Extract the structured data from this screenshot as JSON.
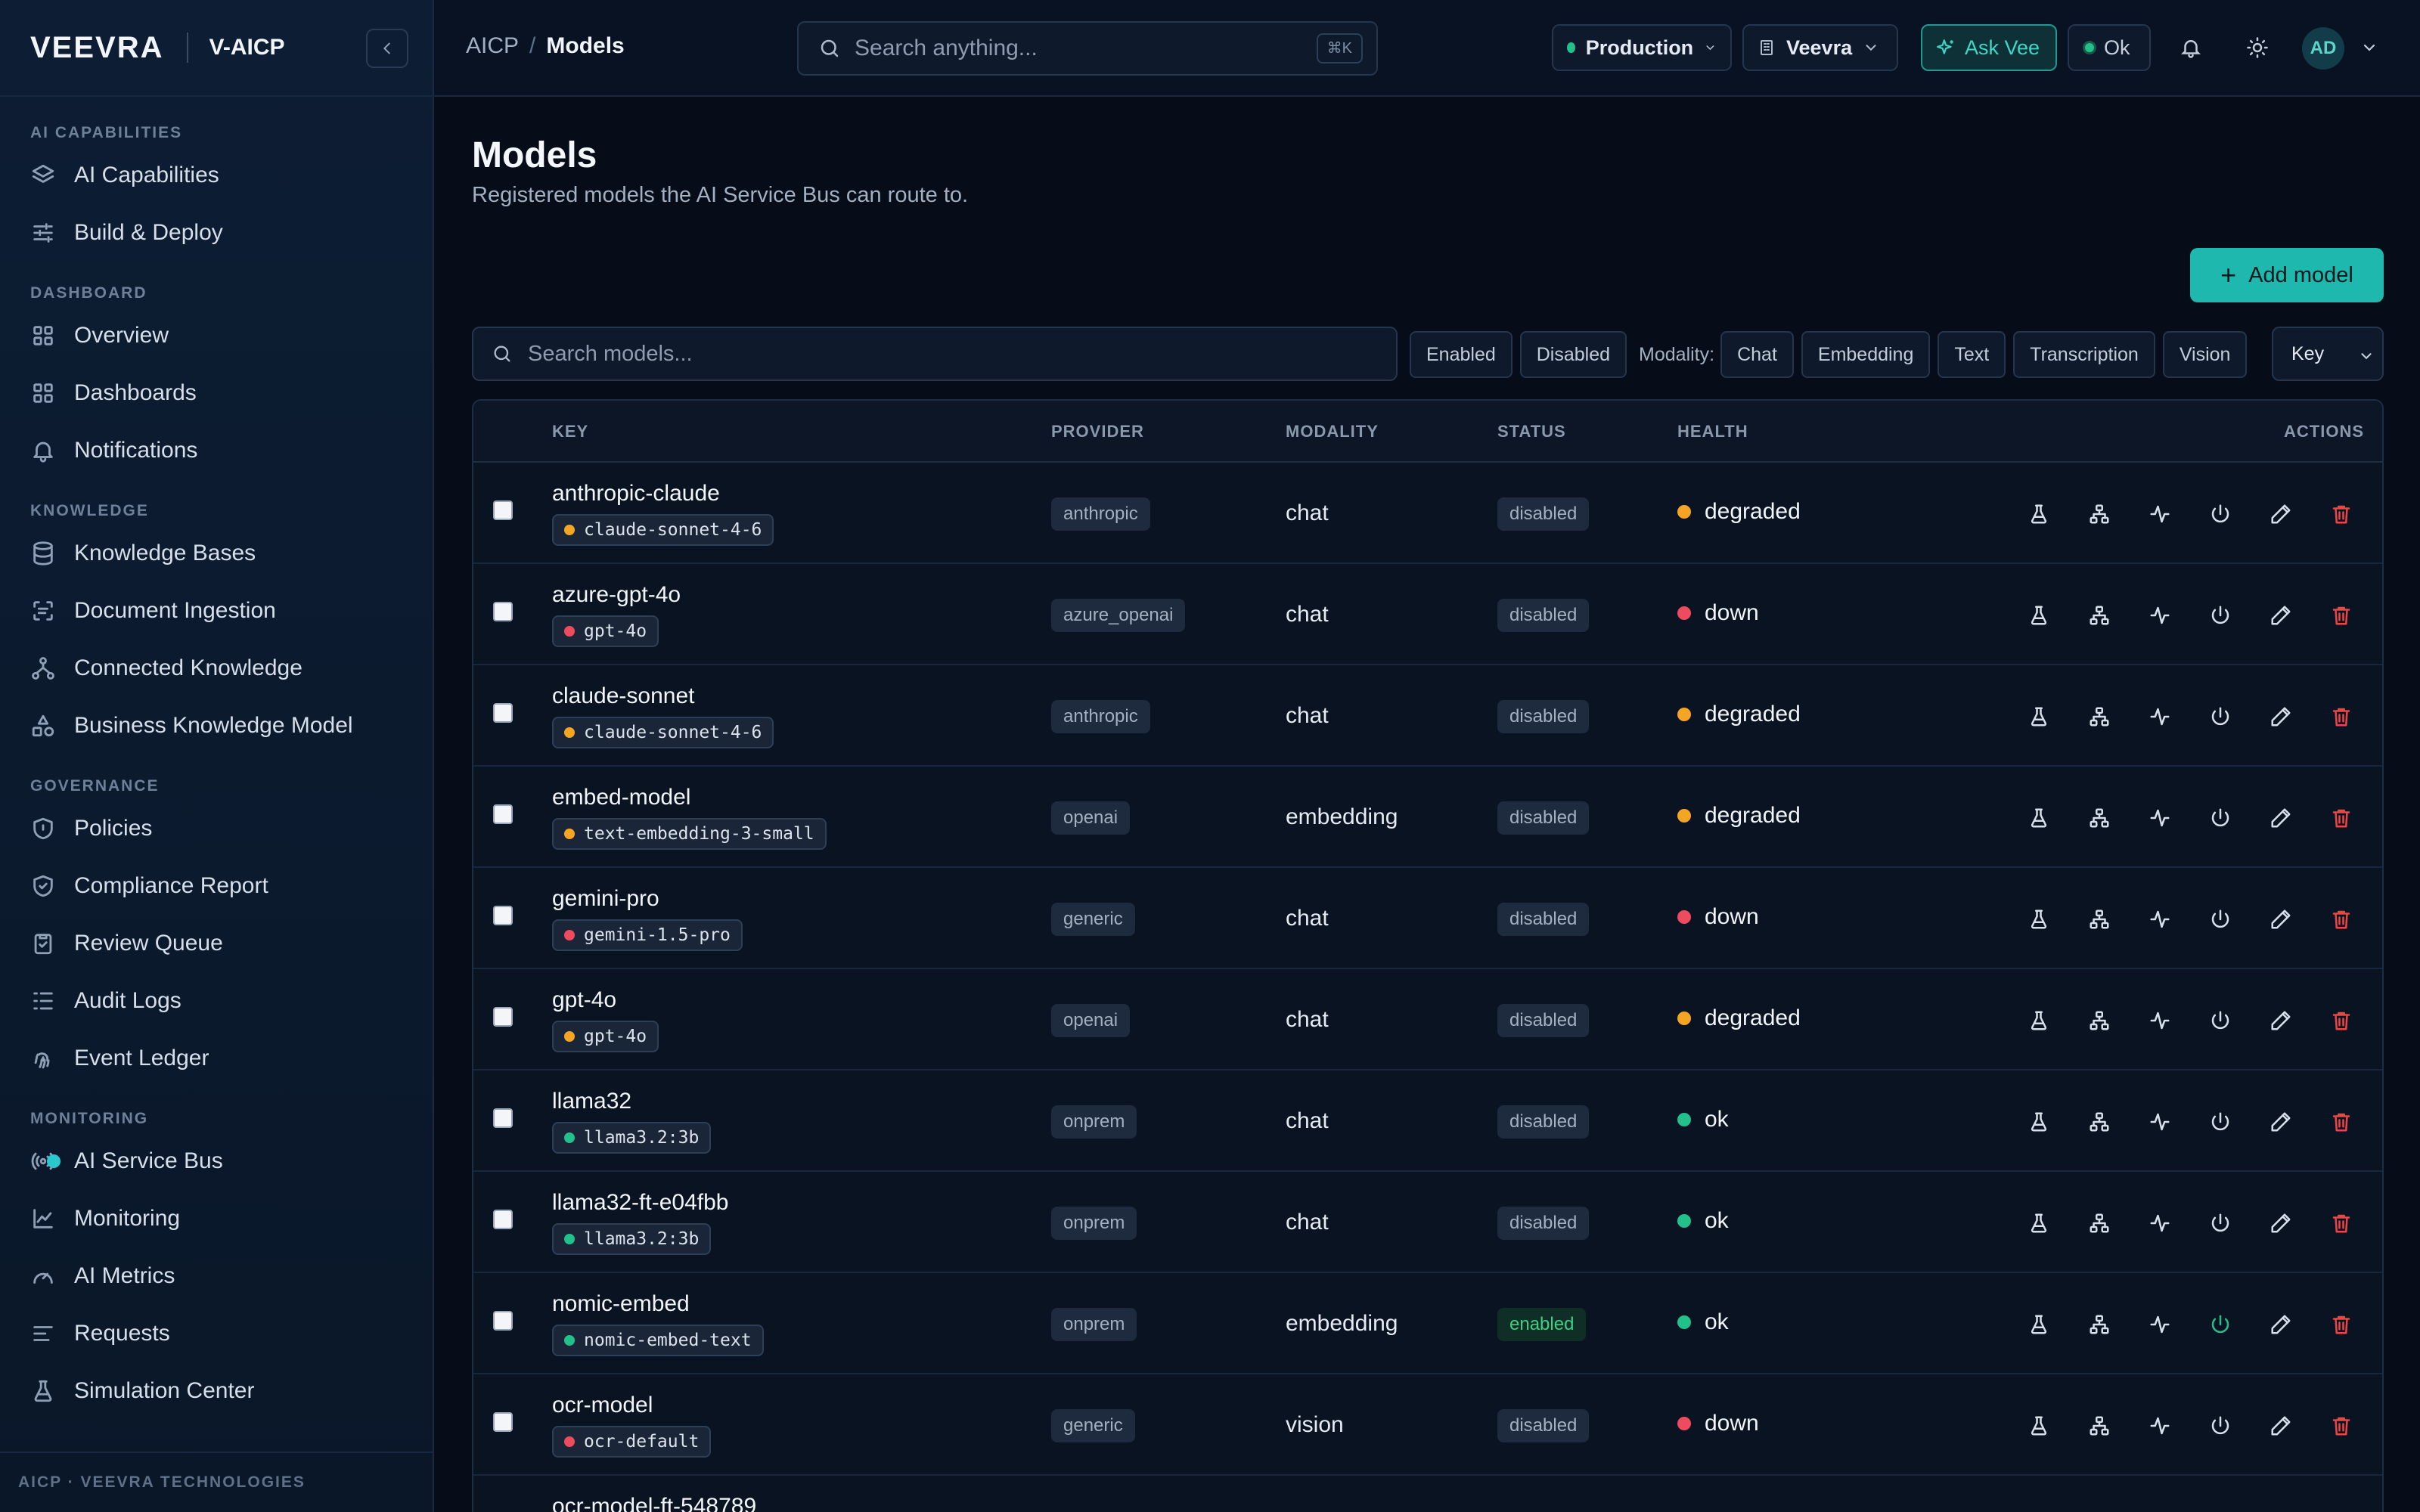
{
  "brand": {
    "logo": "VEEVRA",
    "product": "V-AICP"
  },
  "sidebar": {
    "sections": [
      {
        "title": "AI CAPABILITIES",
        "items": [
          {
            "label": "AI Capabilities",
            "icon": "layers-icon"
          },
          {
            "label": "Build & Deploy",
            "icon": "sliders-icon"
          }
        ]
      },
      {
        "title": "DASHBOARD",
        "items": [
          {
            "label": "Overview",
            "icon": "grid-icon"
          },
          {
            "label": "Dashboards",
            "icon": "grid-icon"
          },
          {
            "label": "Notifications",
            "icon": "bell-icon"
          }
        ]
      },
      {
        "title": "KNOWLEDGE",
        "items": [
          {
            "label": "Knowledge Bases",
            "icon": "database-icon"
          },
          {
            "label": "Document Ingestion",
            "icon": "scan-icon"
          },
          {
            "label": "Connected Knowledge",
            "icon": "network-icon"
          },
          {
            "label": "Business Knowledge Model",
            "icon": "shapes-icon"
          }
        ]
      },
      {
        "title": "GOVERNANCE",
        "items": [
          {
            "label": "Policies",
            "icon": "shield-icon"
          },
          {
            "label": "Compliance Report",
            "icon": "shield-check-icon"
          },
          {
            "label": "Review Queue",
            "icon": "clipboard-icon"
          },
          {
            "label": "Audit Logs",
            "icon": "logs-icon"
          },
          {
            "label": "Event Ledger",
            "icon": "fingerprint-icon"
          }
        ]
      },
      {
        "title": "MONITORING",
        "items": [
          {
            "label": "AI Service Bus",
            "icon": "radio-icon"
          },
          {
            "label": "Monitoring",
            "icon": "chart-line-icon"
          },
          {
            "label": "AI Metrics",
            "icon": "gauge-icon"
          },
          {
            "label": "Requests",
            "icon": "list-icon"
          },
          {
            "label": "Simulation Center",
            "icon": "flask-icon"
          }
        ]
      }
    ],
    "footer": "AICP · VEEVRA TECHNOLOGIES"
  },
  "topbar": {
    "breadcrumb": {
      "parent": "AICP",
      "separator": "/",
      "current": "Models"
    },
    "search_placeholder": "Search anything...",
    "shortcut": "⌘K",
    "environment": "Production",
    "org": "Veevra",
    "ask_label": "Ask Vee",
    "status_label": "Ok",
    "avatar_initials": "AD"
  },
  "page": {
    "title": "Models",
    "subtitle": "Registered models the AI Service Bus can route to.",
    "add_label": "Add model",
    "search_placeholder": "Search models...",
    "filters": {
      "status": [
        "Enabled",
        "Disabled"
      ],
      "modality_label": "Modality:",
      "modality": [
        "Chat",
        "Embedding",
        "Text",
        "Transcription",
        "Vision"
      ]
    },
    "sort": "Key"
  },
  "table": {
    "columns": {
      "key": "KEY",
      "provider": "PROVIDER",
      "modality": "MODALITY",
      "status": "STATUS",
      "health": "HEALTH",
      "actions": "ACTIONS"
    },
    "rows": [
      {
        "key": "anthropic-claude",
        "model": "claude-sonnet-4-6",
        "provider": "anthropic",
        "modality": "chat",
        "status": "disabled",
        "health": "degraded"
      },
      {
        "key": "azure-gpt-4o",
        "model": "gpt-4o",
        "provider": "azure_openai",
        "modality": "chat",
        "status": "disabled",
        "health": "down"
      },
      {
        "key": "claude-sonnet",
        "model": "claude-sonnet-4-6",
        "provider": "anthropic",
        "modality": "chat",
        "status": "disabled",
        "health": "degraded"
      },
      {
        "key": "embed-model",
        "model": "text-embedding-3-small",
        "provider": "openai",
        "modality": "embedding",
        "status": "disabled",
        "health": "degraded"
      },
      {
        "key": "gemini-pro",
        "model": "gemini-1.5-pro",
        "provider": "generic",
        "modality": "chat",
        "status": "disabled",
        "health": "down"
      },
      {
        "key": "gpt-4o",
        "model": "gpt-4o",
        "provider": "openai",
        "modality": "chat",
        "status": "disabled",
        "health": "degraded"
      },
      {
        "key": "llama32",
        "model": "llama3.2:3b",
        "provider": "onprem",
        "modality": "chat",
        "status": "disabled",
        "health": "ok"
      },
      {
        "key": "llama32-ft-e04fbb",
        "model": "llama3.2:3b",
        "provider": "onprem",
        "modality": "chat",
        "status": "disabled",
        "health": "ok"
      },
      {
        "key": "nomic-embed",
        "model": "nomic-embed-text",
        "provider": "onprem",
        "modality": "embedding",
        "status": "enabled",
        "health": "ok"
      },
      {
        "key": "ocr-model",
        "model": "ocr-default",
        "provider": "generic",
        "modality": "vision",
        "status": "disabled",
        "health": "down"
      },
      {
        "key": "ocr-model-ft-548789",
        "model": "",
        "provider": "",
        "modality": "",
        "status": "",
        "health": ""
      }
    ]
  },
  "colors": {
    "accent": "#1fb8ae",
    "health_ok": "#22c08a",
    "health_degraded": "#f5a524",
    "health_down": "#ef4b5e",
    "delete": "#ef4444"
  }
}
